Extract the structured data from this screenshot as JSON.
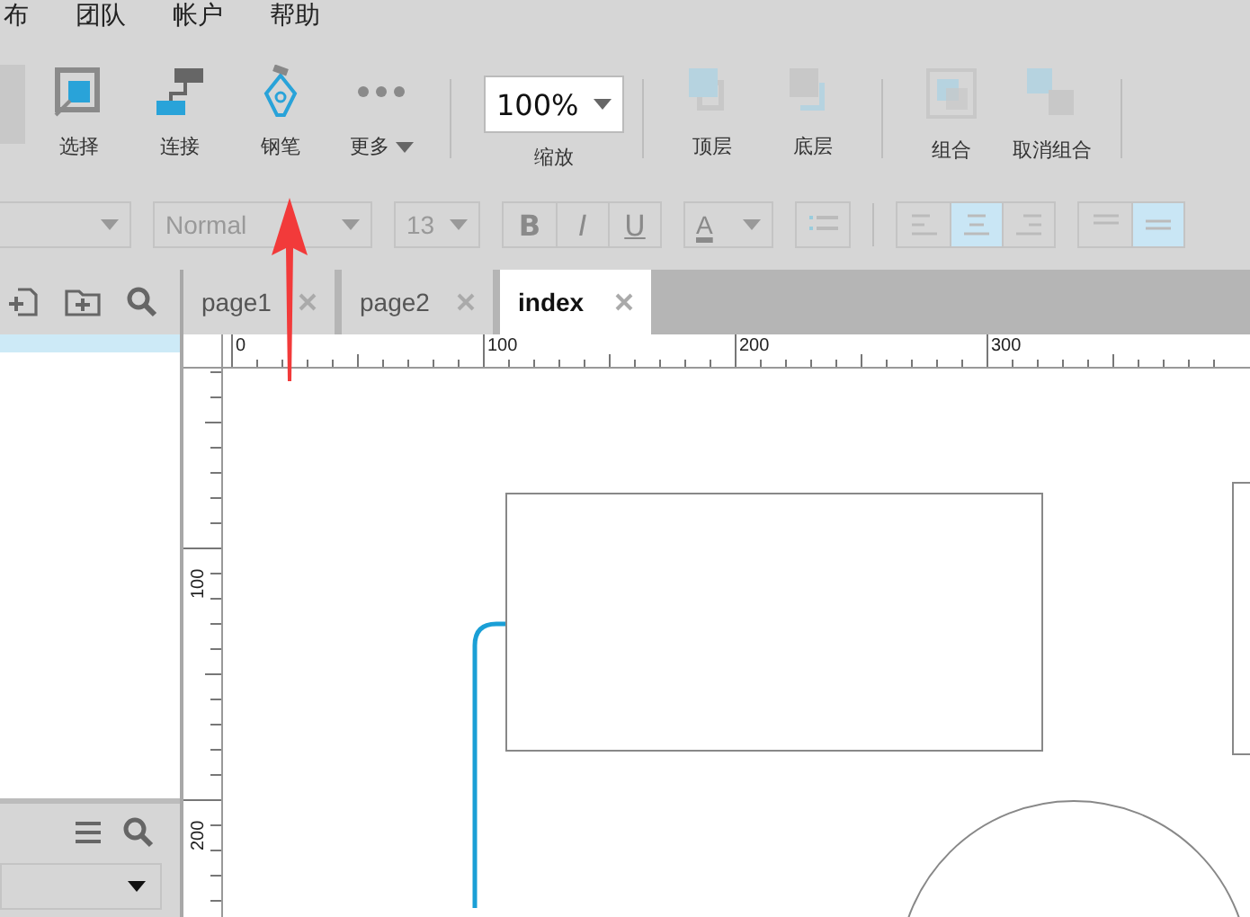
{
  "menu": [
    "布",
    "团队",
    "帐户",
    "帮助"
  ],
  "toolbar": [
    {
      "kind": "tool",
      "label": "选择"
    },
    {
      "kind": "tool",
      "label": "连接"
    },
    {
      "kind": "tool",
      "label": "钢笔"
    },
    {
      "kind": "more",
      "label": "更多"
    },
    {
      "kind": "separator"
    },
    {
      "kind": "zoom",
      "value": "100%",
      "label": "缩放"
    },
    {
      "kind": "separator"
    },
    {
      "kind": "tool",
      "label": "顶层"
    },
    {
      "kind": "tool",
      "label": "底层"
    },
    {
      "kind": "separator"
    },
    {
      "kind": "tool",
      "label": "组合"
    },
    {
      "kind": "tool",
      "label": "取消组合"
    },
    {
      "kind": "separator"
    }
  ],
  "format": {
    "style": "Normal",
    "size": "13",
    "bold": "B",
    "italic": "I",
    "underline": "U",
    "text_color_label": "A",
    "align": [
      {
        "selected": false
      },
      {
        "selected": true
      },
      {
        "selected": false
      }
    ],
    "valign": [
      {
        "selected": false
      },
      {
        "selected": true
      }
    ]
  },
  "tabs": [
    {
      "label": "page1",
      "selected": false
    },
    {
      "label": "page2",
      "selected": false
    },
    {
      "label": "index",
      "selected": true
    }
  ],
  "ruler": {
    "horizontal": [
      "0",
      "100",
      "200",
      "300"
    ],
    "vertical": [
      "100",
      "200"
    ]
  }
}
